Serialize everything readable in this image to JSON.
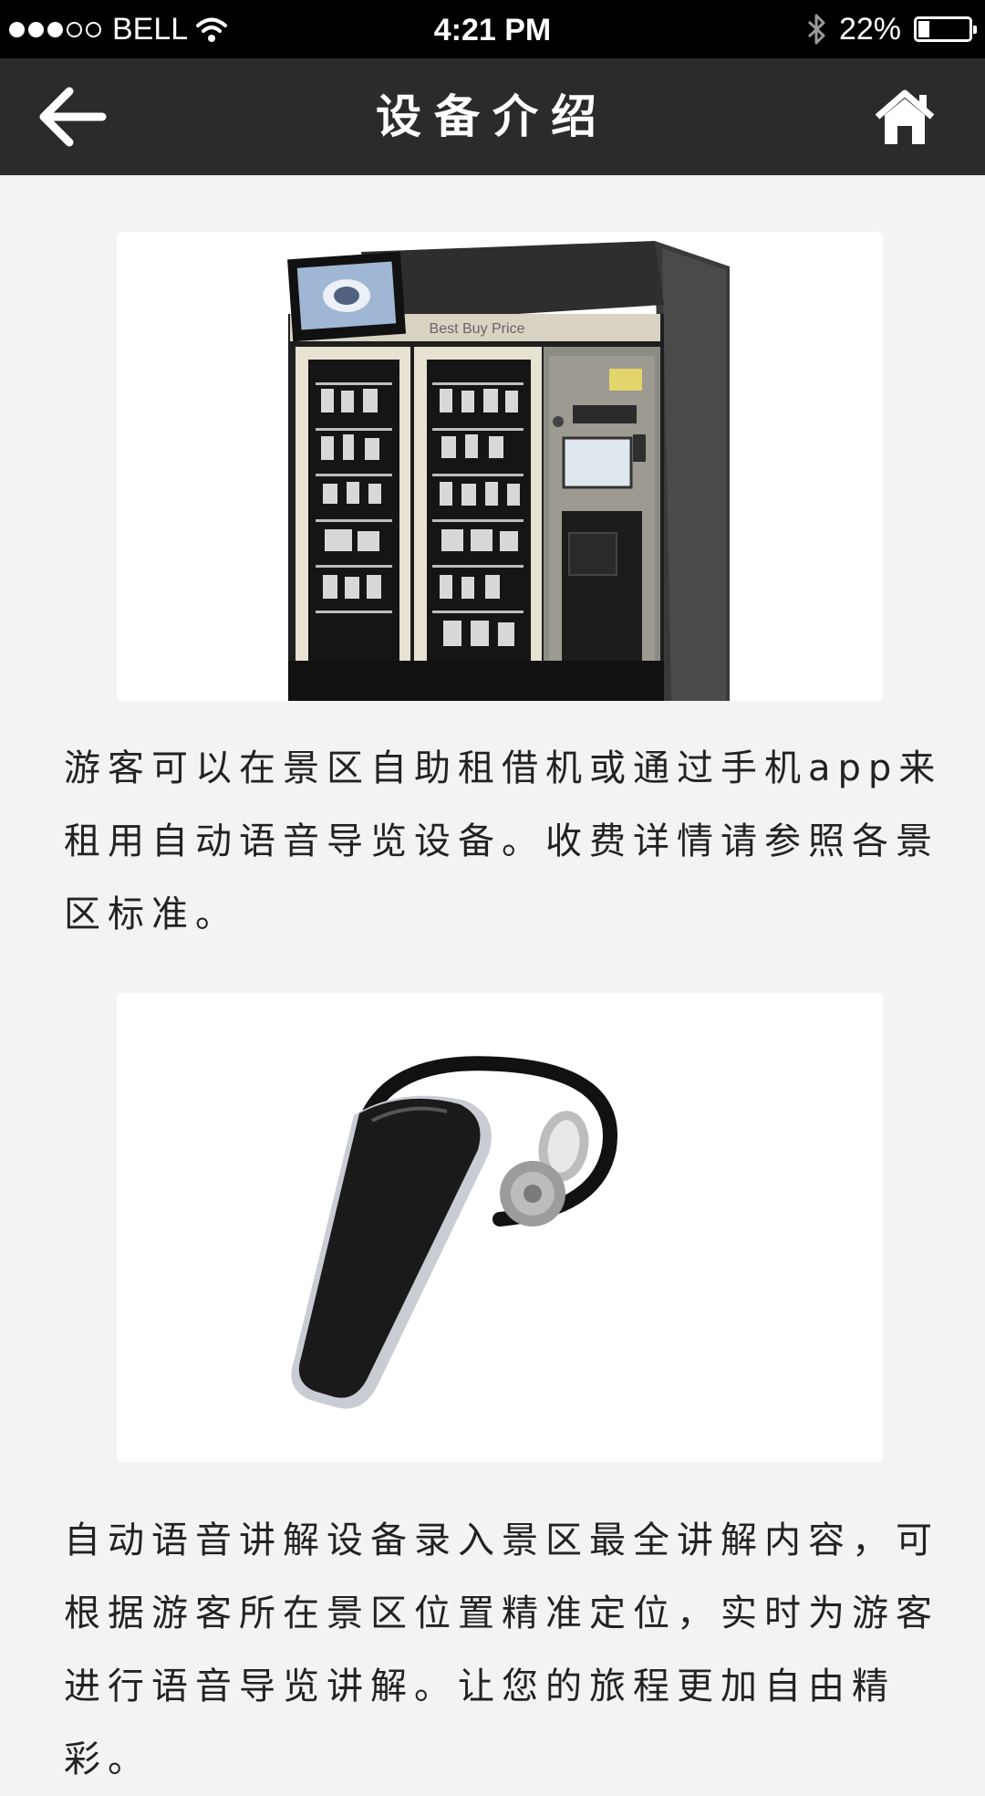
{
  "status_bar": {
    "carrier": "BELL",
    "time": "4:21 PM",
    "battery_percent": "22%",
    "battery_level": 0.22,
    "signal_bars_filled": 3,
    "signal_bars_total": 5
  },
  "nav": {
    "title": "设备介绍",
    "back_icon": "arrow-left-icon",
    "home_icon": "home-icon"
  },
  "sections": [
    {
      "image_label": "Best Buy Price",
      "text": "游客可以在景区自助租借机或通过手机app来租用自动语音导览设备。收费详情请参照各景区标准。"
    },
    {
      "text": "自动语音讲解设备录入景区最全讲解内容，可根据游客所在景区位置精准定位，实时为游客进行语音导览讲解。让您的旅程更加自由精彩。"
    }
  ],
  "colors": {
    "status_bar_bg": "#000000",
    "nav_bg": "#2b2b2b",
    "page_bg": "#f3f3f3",
    "text": "#222222"
  }
}
